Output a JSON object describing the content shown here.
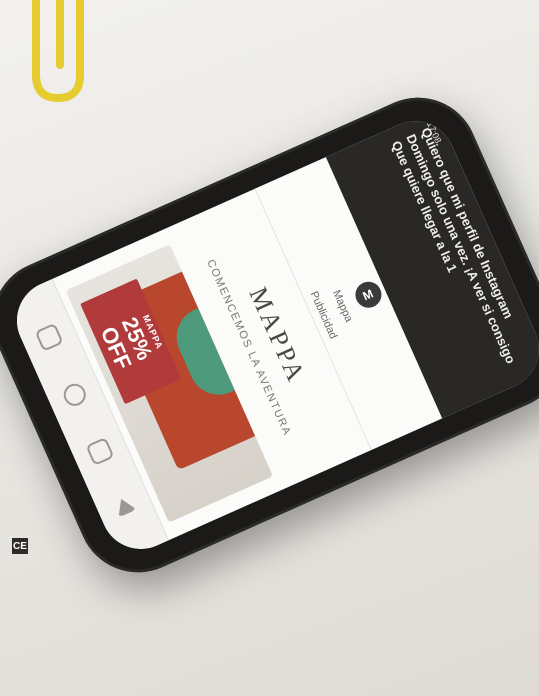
{
  "status": {
    "time": "17:08"
  },
  "notification": {
    "lines": [
      "Quiero que mi perfil de Instagram",
      "Domingo solo una vez. ¡A ver si consigo",
      "Que quiere llegar a la 1"
    ]
  },
  "post": {
    "account_name": "Mappa",
    "account_initial": "M",
    "meta": "Publicidad",
    "brand_title": "MAPPA",
    "brand_subtitle": "COMENCEMOS LA AVENTURA",
    "offer": {
      "top": "MAPPA",
      "percent": "25%",
      "suffix": "OFF"
    }
  },
  "colors": {
    "phone_body": "#1b1a19",
    "offer_bg": "#b13a3a",
    "paperclip": "#e9d23a"
  },
  "icons": [
    "home-icon",
    "search-icon",
    "reels-icon",
    "profile-icon"
  ],
  "label_cc": "CE"
}
